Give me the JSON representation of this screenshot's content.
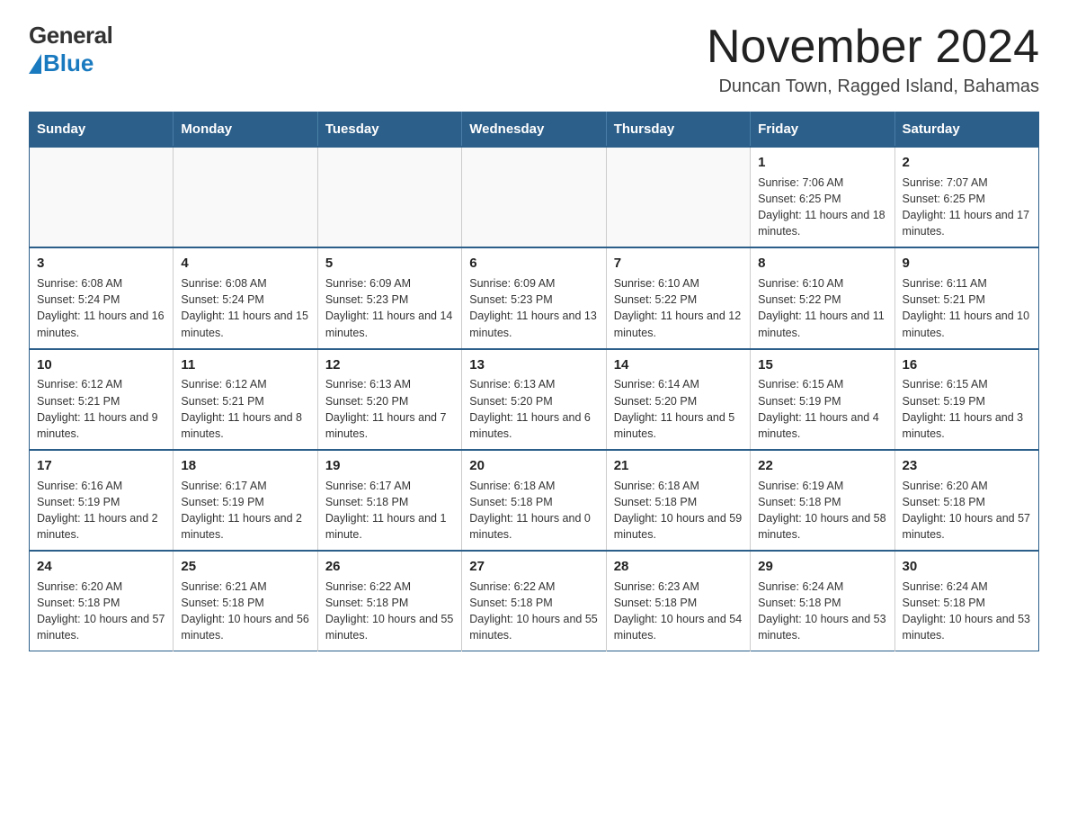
{
  "logo": {
    "general_text": "General",
    "blue_text": "Blue"
  },
  "title": {
    "month_year": "November 2024",
    "location": "Duncan Town, Ragged Island, Bahamas"
  },
  "weekdays": [
    "Sunday",
    "Monday",
    "Tuesday",
    "Wednesday",
    "Thursday",
    "Friday",
    "Saturday"
  ],
  "weeks": [
    [
      {
        "day": "",
        "info": ""
      },
      {
        "day": "",
        "info": ""
      },
      {
        "day": "",
        "info": ""
      },
      {
        "day": "",
        "info": ""
      },
      {
        "day": "",
        "info": ""
      },
      {
        "day": "1",
        "info": "Sunrise: 7:06 AM\nSunset: 6:25 PM\nDaylight: 11 hours and 18 minutes."
      },
      {
        "day": "2",
        "info": "Sunrise: 7:07 AM\nSunset: 6:25 PM\nDaylight: 11 hours and 17 minutes."
      }
    ],
    [
      {
        "day": "3",
        "info": "Sunrise: 6:08 AM\nSunset: 5:24 PM\nDaylight: 11 hours and 16 minutes."
      },
      {
        "day": "4",
        "info": "Sunrise: 6:08 AM\nSunset: 5:24 PM\nDaylight: 11 hours and 15 minutes."
      },
      {
        "day": "5",
        "info": "Sunrise: 6:09 AM\nSunset: 5:23 PM\nDaylight: 11 hours and 14 minutes."
      },
      {
        "day": "6",
        "info": "Sunrise: 6:09 AM\nSunset: 5:23 PM\nDaylight: 11 hours and 13 minutes."
      },
      {
        "day": "7",
        "info": "Sunrise: 6:10 AM\nSunset: 5:22 PM\nDaylight: 11 hours and 12 minutes."
      },
      {
        "day": "8",
        "info": "Sunrise: 6:10 AM\nSunset: 5:22 PM\nDaylight: 11 hours and 11 minutes."
      },
      {
        "day": "9",
        "info": "Sunrise: 6:11 AM\nSunset: 5:21 PM\nDaylight: 11 hours and 10 minutes."
      }
    ],
    [
      {
        "day": "10",
        "info": "Sunrise: 6:12 AM\nSunset: 5:21 PM\nDaylight: 11 hours and 9 minutes."
      },
      {
        "day": "11",
        "info": "Sunrise: 6:12 AM\nSunset: 5:21 PM\nDaylight: 11 hours and 8 minutes."
      },
      {
        "day": "12",
        "info": "Sunrise: 6:13 AM\nSunset: 5:20 PM\nDaylight: 11 hours and 7 minutes."
      },
      {
        "day": "13",
        "info": "Sunrise: 6:13 AM\nSunset: 5:20 PM\nDaylight: 11 hours and 6 minutes."
      },
      {
        "day": "14",
        "info": "Sunrise: 6:14 AM\nSunset: 5:20 PM\nDaylight: 11 hours and 5 minutes."
      },
      {
        "day": "15",
        "info": "Sunrise: 6:15 AM\nSunset: 5:19 PM\nDaylight: 11 hours and 4 minutes."
      },
      {
        "day": "16",
        "info": "Sunrise: 6:15 AM\nSunset: 5:19 PM\nDaylight: 11 hours and 3 minutes."
      }
    ],
    [
      {
        "day": "17",
        "info": "Sunrise: 6:16 AM\nSunset: 5:19 PM\nDaylight: 11 hours and 2 minutes."
      },
      {
        "day": "18",
        "info": "Sunrise: 6:17 AM\nSunset: 5:19 PM\nDaylight: 11 hours and 2 minutes."
      },
      {
        "day": "19",
        "info": "Sunrise: 6:17 AM\nSunset: 5:18 PM\nDaylight: 11 hours and 1 minute."
      },
      {
        "day": "20",
        "info": "Sunrise: 6:18 AM\nSunset: 5:18 PM\nDaylight: 11 hours and 0 minutes."
      },
      {
        "day": "21",
        "info": "Sunrise: 6:18 AM\nSunset: 5:18 PM\nDaylight: 10 hours and 59 minutes."
      },
      {
        "day": "22",
        "info": "Sunrise: 6:19 AM\nSunset: 5:18 PM\nDaylight: 10 hours and 58 minutes."
      },
      {
        "day": "23",
        "info": "Sunrise: 6:20 AM\nSunset: 5:18 PM\nDaylight: 10 hours and 57 minutes."
      }
    ],
    [
      {
        "day": "24",
        "info": "Sunrise: 6:20 AM\nSunset: 5:18 PM\nDaylight: 10 hours and 57 minutes."
      },
      {
        "day": "25",
        "info": "Sunrise: 6:21 AM\nSunset: 5:18 PM\nDaylight: 10 hours and 56 minutes."
      },
      {
        "day": "26",
        "info": "Sunrise: 6:22 AM\nSunset: 5:18 PM\nDaylight: 10 hours and 55 minutes."
      },
      {
        "day": "27",
        "info": "Sunrise: 6:22 AM\nSunset: 5:18 PM\nDaylight: 10 hours and 55 minutes."
      },
      {
        "day": "28",
        "info": "Sunrise: 6:23 AM\nSunset: 5:18 PM\nDaylight: 10 hours and 54 minutes."
      },
      {
        "day": "29",
        "info": "Sunrise: 6:24 AM\nSunset: 5:18 PM\nDaylight: 10 hours and 53 minutes."
      },
      {
        "day": "30",
        "info": "Sunrise: 6:24 AM\nSunset: 5:18 PM\nDaylight: 10 hours and 53 minutes."
      }
    ]
  ]
}
